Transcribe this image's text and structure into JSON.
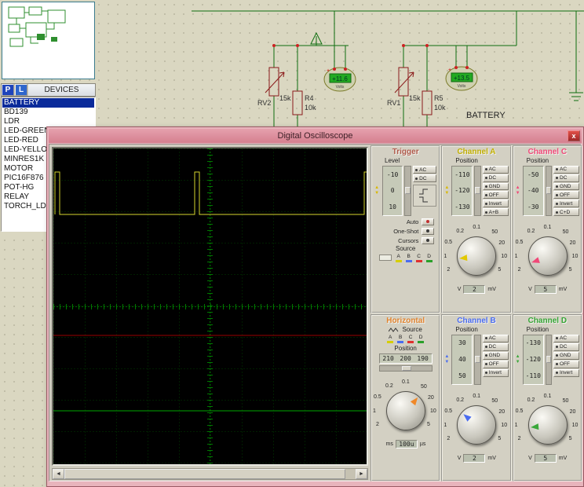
{
  "devices": {
    "p": "P",
    "l": "L",
    "title": "DEVICES",
    "items": [
      "BATTERY",
      "BD139",
      "LDR",
      "LED-GREEN",
      "LED-RED",
      "LED-YELLOW",
      "MINRES1K",
      "MOTOR",
      "PIC16F876",
      "POT-HG",
      "RELAY",
      "TORCH_LDR"
    ],
    "selected": "BATTERY"
  },
  "schematic": {
    "rv2_ref": "RV2",
    "rv2_val": "15k",
    "r4_ref": "R4",
    "r4_val": "10k",
    "rv1_ref": "RV1",
    "rv1_val": "15k",
    "r5_ref": "R5",
    "r5_val": "10k",
    "meter1_value": "+11.6",
    "meter1_unit": "Volts",
    "meter2_value": "+13.5",
    "meter2_unit": "Volts",
    "battery_label": "BATTERY"
  },
  "icons": {
    "up_arrow": "▲",
    "down_arrow": "▼",
    "scroll_left": "◄",
    "scroll_right": "►"
  },
  "scope": {
    "title": "Digital Oscilloscope",
    "close": "x",
    "knob_scale": [
      "2",
      "1",
      "0.5",
      "0.2",
      "0.1",
      "50",
      "20",
      "10",
      "5"
    ],
    "channel_buttons": [
      "AC",
      "DC",
      "GND",
      "OFF",
      "Invert"
    ],
    "trigger": {
      "title": "Trigger",
      "level_label": "Level",
      "level_values": [
        "-10",
        "0",
        "10"
      ],
      "ac": "AC",
      "dc": "DC",
      "auto": "Auto",
      "one_shot": "One-Shot",
      "cursors": "Cursors",
      "source_label": "Source",
      "sources": [
        "A",
        "B",
        "C",
        "D"
      ]
    },
    "horizontal": {
      "title": "Horizontal",
      "source_label": "Source",
      "sources": [
        "A",
        "B",
        "C",
        "D"
      ],
      "position_label": "Position",
      "position_values": [
        "210",
        "200",
        "190"
      ],
      "unit_left": "ms",
      "value": "100u",
      "unit_right": "µs"
    },
    "channels": [
      {
        "title": "Channel A",
        "position_label": "Position",
        "position_values": [
          "-110",
          "-120",
          "-130"
        ],
        "sum": "A+B",
        "unit_left": "V",
        "value": "2",
        "unit_right": "mV"
      },
      {
        "title": "Channel C",
        "position_label": "Position",
        "position_values": [
          "-50",
          "-40",
          "-30"
        ],
        "sum": "C+D",
        "unit_left": "V",
        "value": "5",
        "unit_right": "mV"
      },
      {
        "title": "Channel B",
        "position_label": "Position",
        "position_values": [
          "30",
          "40",
          "50"
        ],
        "unit_left": "V",
        "value": "2",
        "unit_right": "mV"
      },
      {
        "title": "Channel D",
        "position_label": "Position",
        "position_values": [
          "-130",
          "-120",
          "-110"
        ],
        "unit_left": "V",
        "value": "5",
        "unit_right": "mV"
      }
    ]
  },
  "colors": {
    "channel_a": "#e2c800",
    "channel_b": "#4a6cf0",
    "channel_c": "#f04878",
    "channel_d": "#3aa83a",
    "trigger_header": "#b05a4a",
    "horizontal_header": "#e08430",
    "trace_a": "#d6d62e",
    "trace_c": "#9a0000",
    "trace_d": "#00a800",
    "selection": "#0a2a9a",
    "titlebar": "#e5a0ad"
  }
}
